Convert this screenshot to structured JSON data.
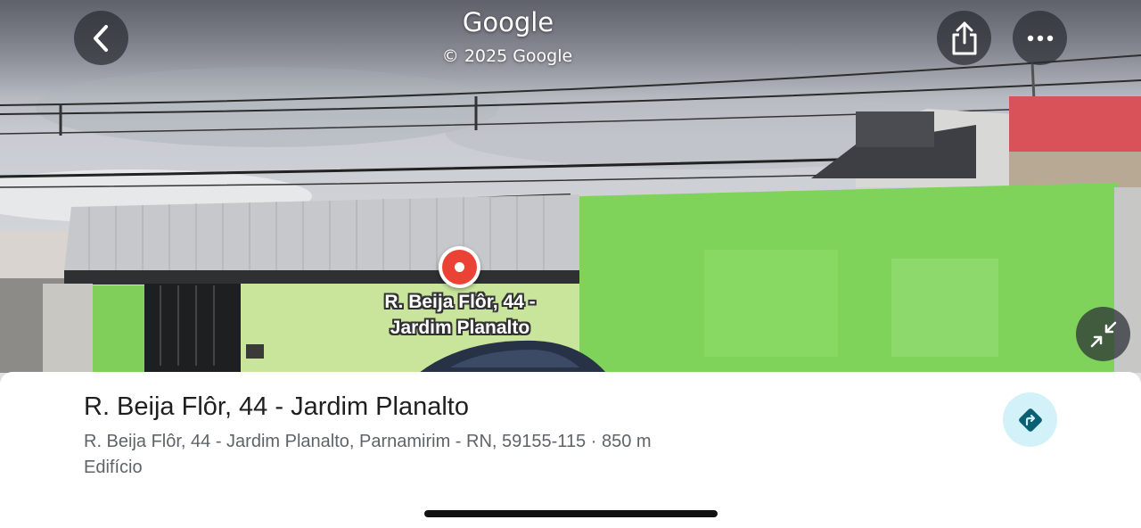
{
  "header": {
    "brand": "Google",
    "copyright": "© 2025 Google"
  },
  "controls": {
    "back_icon": "chevron-left-icon",
    "share_icon": "share-icon",
    "more_icon": "more-horizontal-icon",
    "collapse_icon": "collapse-arrows-icon"
  },
  "street_view": {
    "pin_color": "#ea4335",
    "place_label_line1": "R. Beija Flôr, 44 -",
    "place_label_line2": "Jardim Planalto"
  },
  "place": {
    "title": "R. Beija Flôr, 44 - Jardim Planalto",
    "address": "R. Beija Flôr, 44 - Jardim Planalto, Parnamirim - RN, 59155-115 · 850 m",
    "category": "Edifício",
    "directions_icon": "directions-icon",
    "accent": "#0b5f73"
  }
}
